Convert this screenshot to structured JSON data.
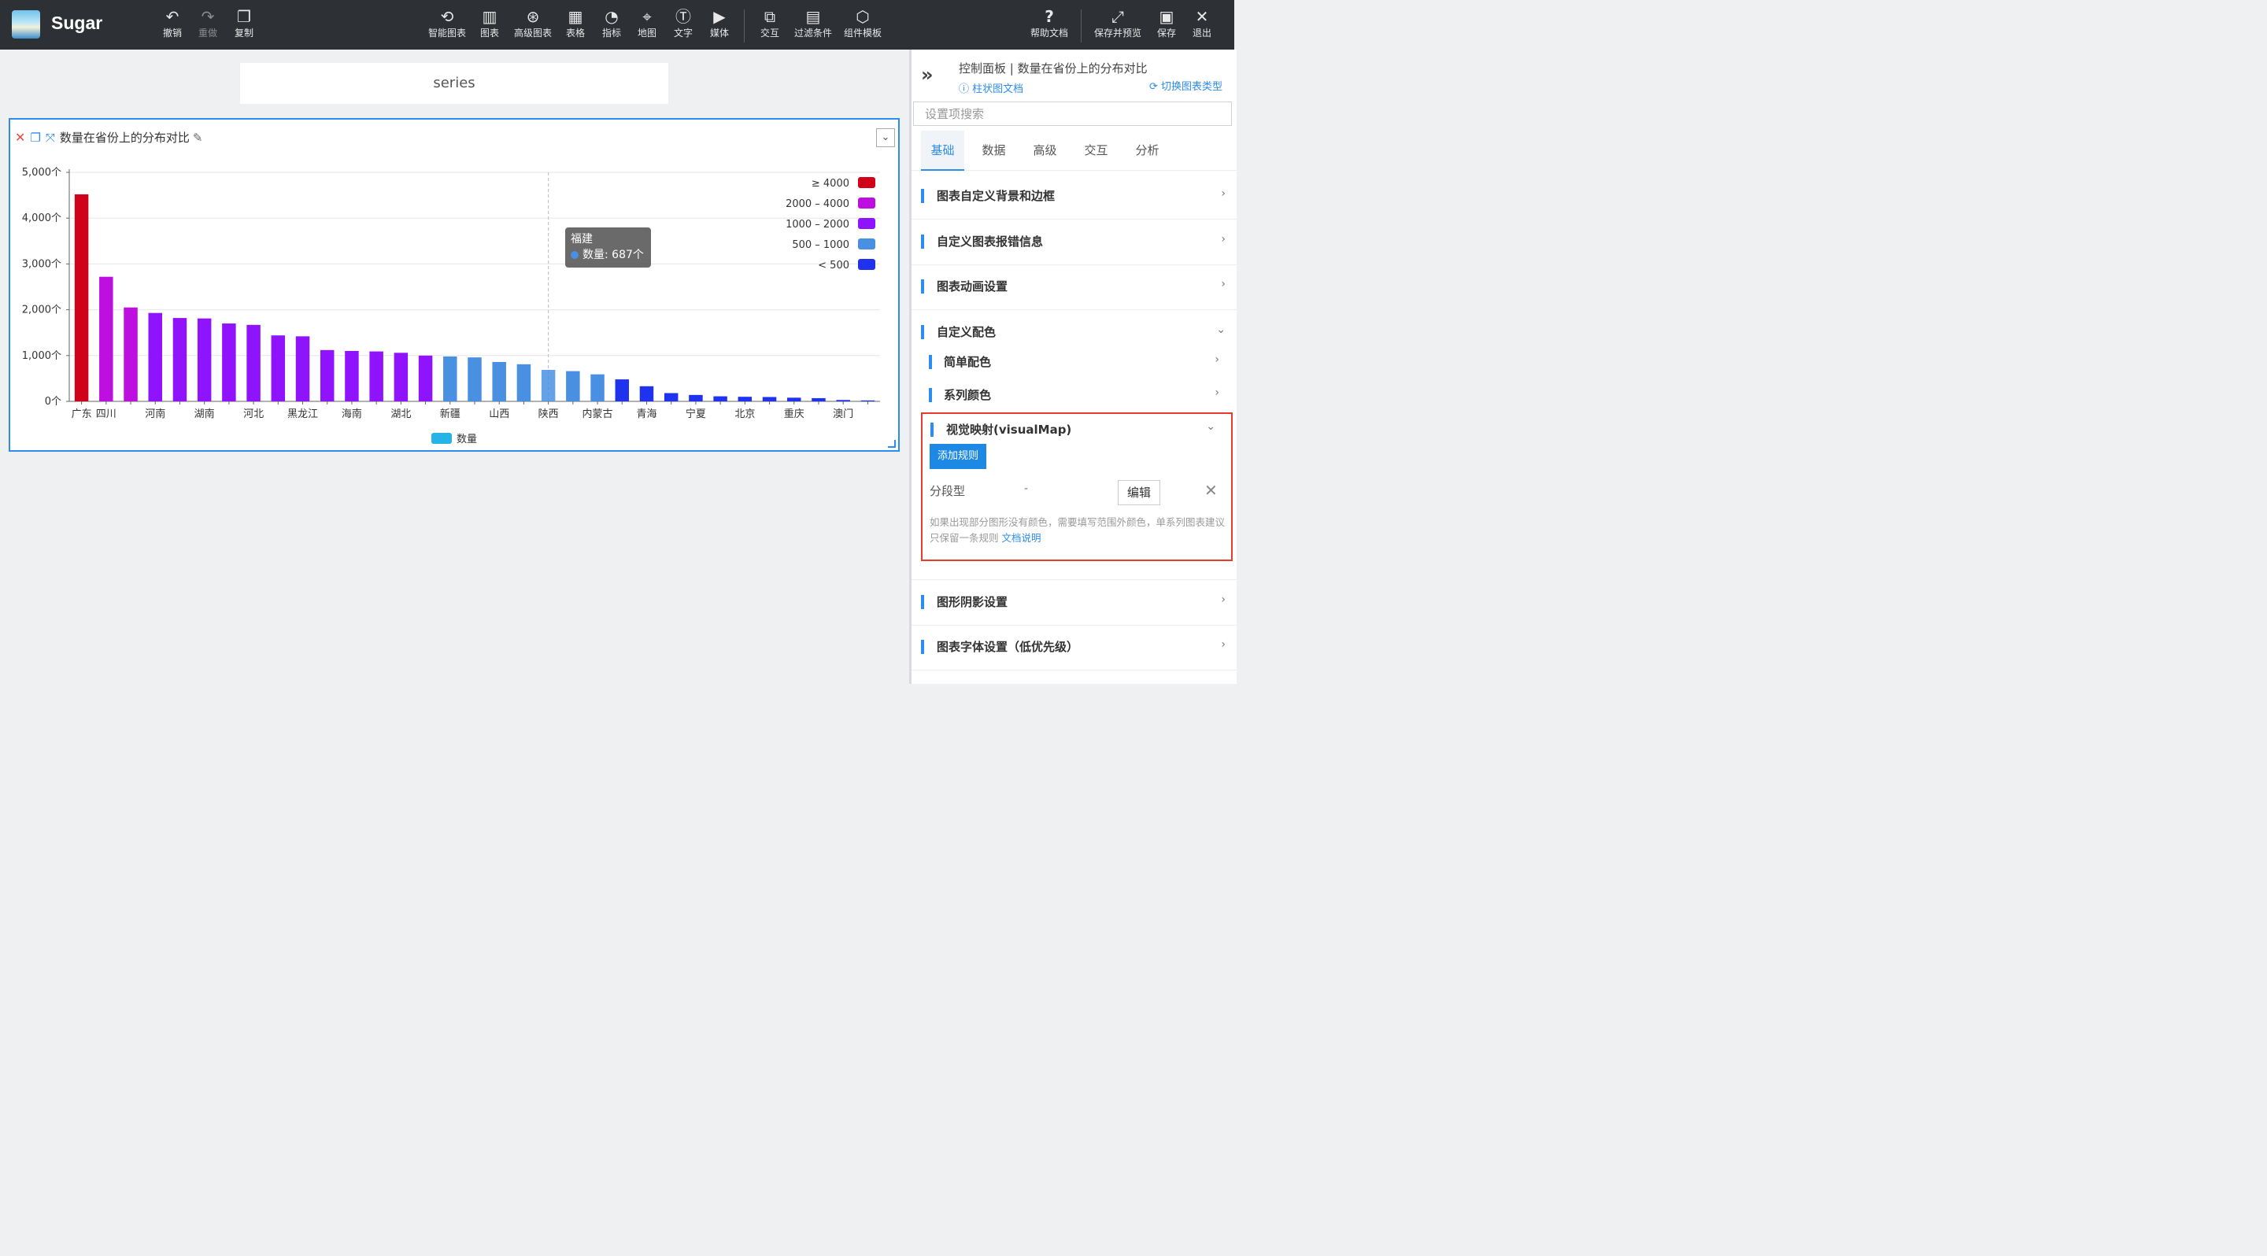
{
  "app": {
    "name": "Sugar"
  },
  "toolbar": {
    "undo": "撤销",
    "redo": "重做",
    "copy": "复制",
    "smart_chart": "智能图表",
    "chart": "图表",
    "advanced_chart": "高级图表",
    "table": "表格",
    "indicator": "指标",
    "map": "地图",
    "text": "文字",
    "media": "媒体",
    "interaction": "交互",
    "filter": "过滤条件",
    "component_template": "组件模板",
    "help": "帮助文档",
    "save_preview": "保存并预览",
    "save": "保存",
    "exit": "退出"
  },
  "canvas": {
    "series_label": "series",
    "card_title": "数量在省份上的分布对比"
  },
  "tooltip": {
    "title": "福建",
    "line": "数量: 687个",
    "dot_color": "#4a90e2"
  },
  "chart_data": {
    "type": "bar",
    "categories": [
      "广东",
      "四川",
      "",
      "河南",
      "",
      "湖南",
      "",
      "河北",
      "",
      "黑龙江",
      "",
      "海南",
      "",
      "湖北",
      "",
      "新疆",
      "",
      "山西",
      "",
      "陕西",
      "",
      "内蒙古",
      "",
      "青海",
      "",
      "宁夏",
      "",
      "北京",
      "",
      "重庆",
      "",
      "澳门"
    ],
    "values": [
      4520,
      2720,
      2050,
      1930,
      1820,
      1810,
      1700,
      1670,
      1440,
      1420,
      1120,
      1100,
      1090,
      1060,
      1000,
      980,
      960,
      860,
      810,
      687,
      660,
      590,
      480,
      330,
      180,
      140,
      110,
      100,
      95,
      80,
      70,
      30,
      20
    ],
    "ylim": [
      0,
      5000
    ],
    "yticks": [
      "5,000个",
      "4,000个",
      "3,000个",
      "2,000个",
      "1,000个",
      "0个"
    ],
    "legend_bottom": "数量",
    "visual_map": [
      {
        "label": "≥ 4000",
        "color": "#d0021b"
      },
      {
        "label": "2000 – 4000",
        "color": "#bd10e0"
      },
      {
        "label": "1000 – 2000",
        "color": "#9013fe"
      },
      {
        "label": "500 – 1000",
        "color": "#4a90e2"
      },
      {
        "label": "< 500",
        "color": "#1f33ee"
      }
    ],
    "series_color": "#26b4e6",
    "highlighted": "福建",
    "grid": true
  },
  "panel": {
    "title": "控制面板 | 数量在省份上的分布对比",
    "doc_link": "柱状图文档",
    "switch_type": "切换图表类型",
    "search_placeholder": "设置项搜索",
    "tabs": [
      "基础",
      "数据",
      "高级",
      "交互",
      "分析"
    ],
    "sections": {
      "background": "图表自定义背景和边框",
      "error_info": "自定义图表报错信息",
      "animation": "图表动画设置",
      "custom_color": "自定义配色",
      "simple_color": "简单配色",
      "series_color": "系列颜色",
      "visual_map": "视觉映射(visualMap)",
      "shadow": "图形阴影设置",
      "font": "图表字体设置（低优先级）"
    },
    "visual_map": {
      "add_rule": "添加规则",
      "rule_type": "分段型",
      "rule_dash": "-",
      "edit": "编辑",
      "hint": "如果出现部分图形没有颜色，需要填写范围外颜色，单系列图表建议只保留一条规则 ",
      "hint_link": "文档说明"
    }
  }
}
